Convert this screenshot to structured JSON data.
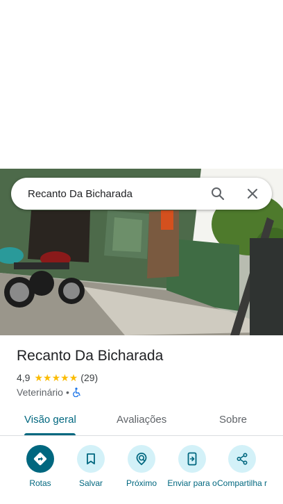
{
  "search": {
    "query": "Recanto Da Bicharada"
  },
  "place": {
    "name": "Recanto Da Bicharada",
    "rating": "4,9",
    "stars": 5,
    "reviews_count": "(29)",
    "category": "Veterinário",
    "separator": "•"
  },
  "tabs": [
    {
      "label": "Visão geral",
      "active": true
    },
    {
      "label": "Avaliações",
      "active": false
    },
    {
      "label": "Sobre",
      "active": false
    }
  ],
  "actions": [
    {
      "label": "Rotas",
      "icon": "directions-icon"
    },
    {
      "label": "Salvar",
      "icon": "bookmark-icon"
    },
    {
      "label": "Próximo",
      "icon": "nearby-icon"
    },
    {
      "label": "Enviar para o",
      "icon": "send-to-phone-icon"
    },
    {
      "label": "Compartilha r",
      "icon": "share-icon"
    }
  ],
  "colors": {
    "accent": "#00677f",
    "accent_light": "#d3f1f8",
    "star": "#fbbc04"
  }
}
